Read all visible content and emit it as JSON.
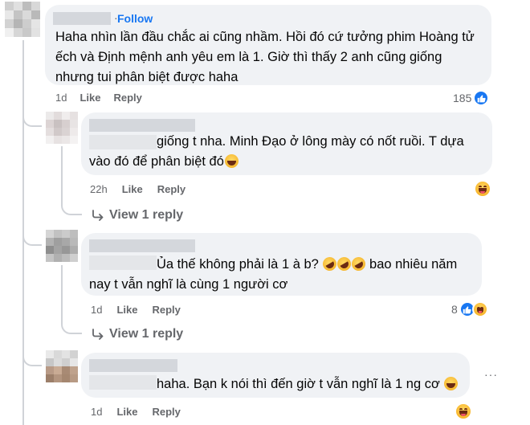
{
  "comments": [
    {
      "follow_label": "Follow",
      "text_lines": [
        "Haha nhìn lần đầu chắc ai cũng nhầm. Hồi đó cứ tưởng phim Hoàng tử",
        "ếch và Định mệnh anh yêu em là 1. Giờ thì thấy 2 anh cũng giống",
        "nhưng tui phân biệt được haha"
      ],
      "time": "1d",
      "like_label": "Like",
      "reply_label": "Reply",
      "reaction_count": "185",
      "reactions": [
        "like-icon"
      ]
    },
    {
      "text_lines": [
        "giống t nha. Minh Đạo ở lông mày có nốt ruồi. T dựa",
        "vào đó để phân biệt đó"
      ],
      "time": "22h",
      "like_label": "Like",
      "reply_label": "Reply",
      "reactions": [
        "haha-icon"
      ],
      "view_replies": "View 1 reply"
    },
    {
      "text_lines": [
        "Ủa thế không phải là 1 à b?",
        "bao nhiêu năm",
        "nay t vẫn nghĩ là cùng 1 người cơ"
      ],
      "time": "1d",
      "like_label": "Like",
      "reply_label": "Reply",
      "reaction_count": "8",
      "reactions": [
        "like-icon",
        "haha-icon"
      ],
      "view_replies": "View 1 reply"
    },
    {
      "text_lines": [
        "haha. Bạn k nói thì đến giờ t vẫn nghĩ là 1 ng cơ"
      ],
      "time": "1d",
      "like_label": "Like",
      "reply_label": "Reply",
      "reactions": [
        "haha-icon"
      ]
    }
  ],
  "colors": {
    "bubble": "#f0f2f5",
    "link_blue": "#1877f2",
    "meta_gray": "#65676b"
  }
}
